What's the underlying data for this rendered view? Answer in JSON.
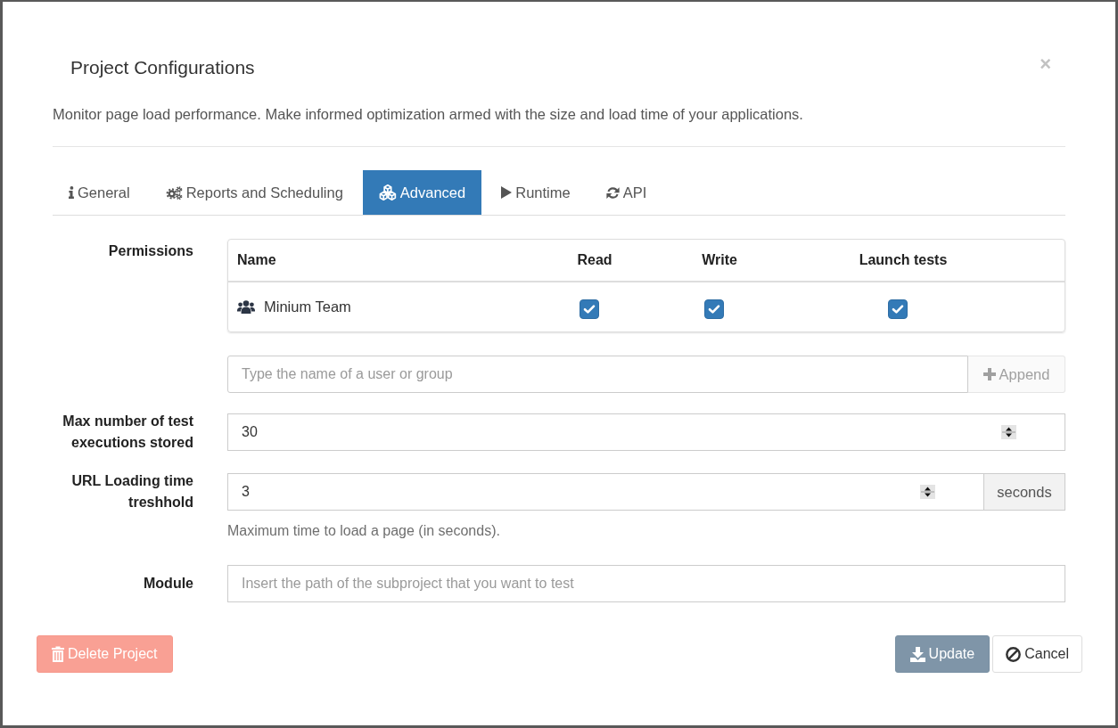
{
  "dialog": {
    "title": "Project Configurations",
    "close": "×",
    "description": "Monitor page load performance. Make informed optimization armed with the size and load time of your applications."
  },
  "tabs": [
    {
      "label": "General",
      "selected": false
    },
    {
      "label": "Reports and Scheduling",
      "selected": false
    },
    {
      "label": "Advanced",
      "selected": true
    },
    {
      "label": "Runtime",
      "selected": false
    },
    {
      "label": "API",
      "selected": false
    }
  ],
  "permissions": {
    "label": "Permissions",
    "columns": [
      "Name",
      "Read",
      "Write",
      "Launch tests"
    ],
    "rows": [
      {
        "name": "Minium Team",
        "read": true,
        "write": true,
        "launch_tests": true
      }
    ]
  },
  "add_member": {
    "placeholder": "Type the name of a user or group",
    "button": "Append"
  },
  "fields": [
    {
      "kind": "number",
      "label": "Max number of test executions stored",
      "value": "30"
    },
    {
      "kind": "number",
      "label": "URL Loading time treshhold",
      "value": "3",
      "addon": "seconds",
      "help": "Maximum time to load a page (in seconds)."
    },
    {
      "kind": "text",
      "label": "Module",
      "placeholder": "Insert the path of the subproject that you want to test"
    }
  ],
  "footer": {
    "delete": "Delete Project",
    "update": "Update",
    "cancel": "Cancel"
  }
}
